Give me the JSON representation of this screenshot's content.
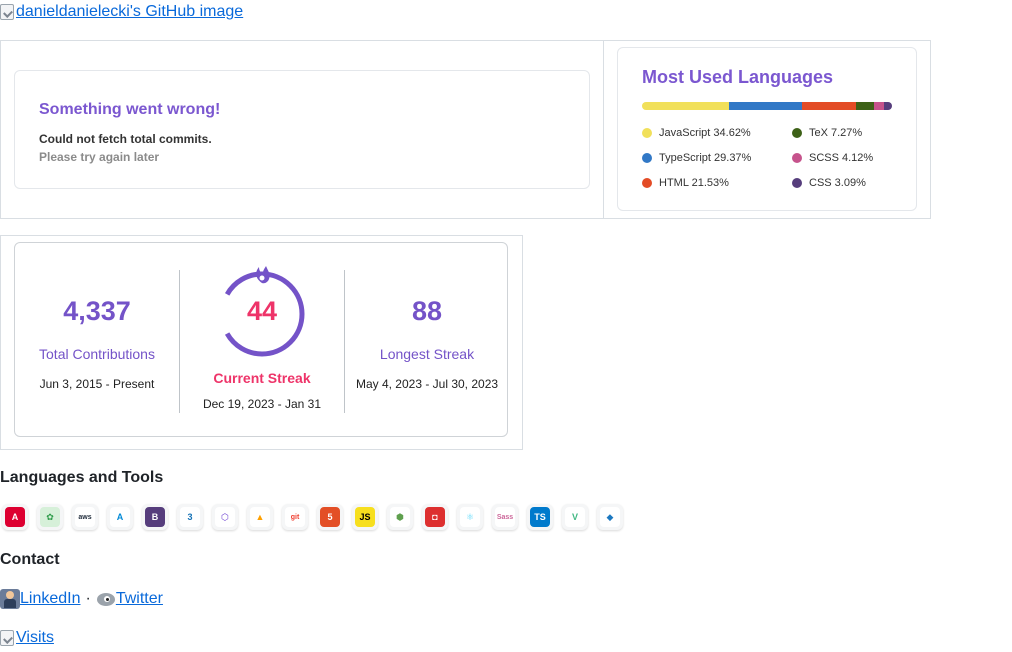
{
  "header_image": {
    "alt": "danieldanielecki's GitHub image"
  },
  "commits_card": {
    "title": "Something went wrong!",
    "message": "Could not fetch total commits.",
    "submessage": "Please try again later"
  },
  "languages_card": {
    "title": "Most Used Languages",
    "items": [
      {
        "name": "JavaScript",
        "percent": "34.62%",
        "value": 34.62,
        "color": "#f1e05a"
      },
      {
        "name": "TypeScript",
        "percent": "29.37%",
        "value": 29.37,
        "color": "#3178c6"
      },
      {
        "name": "HTML",
        "percent": "21.53%",
        "value": 21.53,
        "color": "#e34c26"
      },
      {
        "name": "TeX",
        "percent": "7.27%",
        "value": 7.27,
        "color": "#3d6117"
      },
      {
        "name": "SCSS",
        "percent": "4.12%",
        "value": 4.12,
        "color": "#c6538c"
      },
      {
        "name": "CSS",
        "percent": "3.09%",
        "value": 3.09,
        "color": "#563d7c"
      }
    ]
  },
  "streak_card": {
    "total": {
      "value": "4,337",
      "label": "Total Contributions",
      "range": "Jun 3, 2015 - Present"
    },
    "current": {
      "value": "44",
      "label": "Current Streak",
      "range": "Dec 19, 2023 - Jan 31"
    },
    "longest": {
      "value": "88",
      "label": "Longest Streak",
      "range": "May 4, 2023 - Jul 30, 2023"
    },
    "colors": {
      "accent": "#7453c8",
      "fire": "#ee3469"
    }
  },
  "tools_section": {
    "heading": "Languages and Tools",
    "tools": [
      {
        "name": "angular-icon",
        "glyph": "A",
        "bg": "#dd0031",
        "fg": "#ffffff"
      },
      {
        "name": "ai-icon",
        "glyph": "✿",
        "bg": "#d6f0d9",
        "fg": "#2e9c4a"
      },
      {
        "name": "aws-icon",
        "glyph": "aws",
        "bg": "#ffffff",
        "fg": "#232f3e"
      },
      {
        "name": "azure-icon",
        "glyph": "A",
        "bg": "#ffffff",
        "fg": "#0089d6"
      },
      {
        "name": "bootstrap-icon",
        "glyph": "B",
        "bg": "#563d7c",
        "fg": "#ffffff"
      },
      {
        "name": "css3-icon",
        "glyph": "3",
        "bg": "#ffffff",
        "fg": "#1572b6"
      },
      {
        "name": "graphql-icon",
        "glyph": "⬡",
        "bg": "#ffffff",
        "fg": "#6b3fd1"
      },
      {
        "name": "firebase-icon",
        "glyph": "▲",
        "bg": "#ffffff",
        "fg": "#ffa000"
      },
      {
        "name": "git-icon",
        "glyph": "git",
        "bg": "#ffffff",
        "fg": "#f03c2e"
      },
      {
        "name": "html5-icon",
        "glyph": "5",
        "bg": "#e34f26",
        "fg": "#ffffff"
      },
      {
        "name": "javascript-icon",
        "glyph": "JS",
        "bg": "#f7df1e",
        "fg": "#000000"
      },
      {
        "name": "nodejs-icon",
        "glyph": "⬢",
        "bg": "#ffffff",
        "fg": "#5fa04e"
      },
      {
        "name": "nx-icon",
        "glyph": "◘",
        "bg": "#dd2f2f",
        "fg": "#ffffff"
      },
      {
        "name": "react-icon",
        "glyph": "⚛",
        "bg": "#ffffff",
        "fg": "#61dafb"
      },
      {
        "name": "sass-icon",
        "glyph": "Sass",
        "bg": "#ffffff",
        "fg": "#cc6699"
      },
      {
        "name": "typescript-icon",
        "glyph": "TS",
        "bg": "#007acc",
        "fg": "#ffffff"
      },
      {
        "name": "vue-icon",
        "glyph": "V",
        "bg": "#ffffff",
        "fg": "#41b883"
      },
      {
        "name": "webpack-icon",
        "glyph": "◆",
        "bg": "#ffffff",
        "fg": "#1c78c0"
      }
    ]
  },
  "contact_section": {
    "heading": "Contact",
    "linkedin": "LinkedIn",
    "separator": "·",
    "twitter": "Twitter"
  },
  "visits_image": {
    "alt": "Visits"
  }
}
